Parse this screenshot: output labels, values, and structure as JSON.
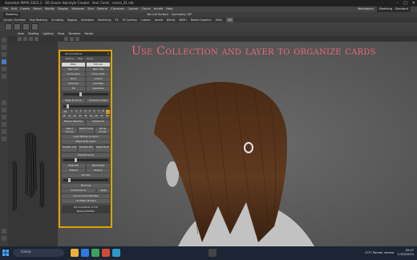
{
  "window": {
    "title": "Autodesk MAYA 2023.3 - 3D Groom Hairstyle Creator · Hair Cards · scene_01.mb",
    "controls": [
      "–",
      "□",
      "✕"
    ]
  },
  "menubar": {
    "items": [
      "File",
      "Edit",
      "Create",
      "Select",
      "Modify",
      "Display",
      "Windows",
      "Skin",
      "Deform",
      "Constrain",
      "Control",
      "Cache",
      "Arnold",
      "Help"
    ],
    "workspace_label": "Workspace:",
    "workspace_value": "Modeling - Standard"
  },
  "statusline": {
    "mode": "Modeling",
    "items": [
      "No Live Surface",
      "Symmetry: Off"
    ]
  },
  "shelf": {
    "tabs": [
      "Curves / Surfaces",
      "Poly Modeling",
      "Sculpting",
      "Rigging",
      "Animation",
      "Rendering",
      "FX",
      "FX Caching",
      "Custom",
      "Arnold",
      "Bifrost",
      "MASH",
      "Motion Graphics",
      "XGen",
      "GS"
    ],
    "active_tab": "GS"
  },
  "panel_menu": [
    "View",
    "Shading",
    "Lighting",
    "Show",
    "Renderer",
    "Panels"
  ],
  "viewport": {
    "heading": "Use Collection and layer to organize cards"
  },
  "gs_panel": {
    "title": "GS CurveTools",
    "close": "✕",
    "menu": [
      "Options",
      "Help",
      "About"
    ],
    "buttons": {
      "warp": "Warp",
      "extrude": "Extrude",
      "new_card": "New Card",
      "new_tube": "New Tube",
      "curve_card": "Curve Card",
      "curve_tube": "Curve Tube",
      "bind": "Bind",
      "unbind": "Unbind",
      "add_card": "Add Card",
      "add_tube": "Add Tube",
      "fill": "Fill",
      "subdivide": "Subdivide",
      "edge_to_curve": "Edge To Curve",
      "cards_to_curves": "Cards To Curves",
      "all": "All",
      "layer_row": [
        "1",
        "2",
        "3",
        "4",
        "5",
        "6",
        "7",
        "8",
        "9"
      ],
      "layer_row2": [
        "10",
        "11",
        "12",
        "13",
        "14",
        "15",
        "16",
        "17",
        "18"
      ],
      "extract_selected": "Extract Selected",
      "extract_all": "Extract All",
      "select_curves": "Select Curves",
      "select_cards": "Select Cards",
      "group_curves": "Group Curves",
      "layer_names_colors": "Layer Names & Colors",
      "regroup_by_layer": "Regroup By Layer",
      "transfer_uvs": "Transfer UVs",
      "transfer_attr": "Transfer Attr.",
      "reset_pivot": "Reset Pivot",
      "smooth_curve": "Smooth Curve",
      "duplicate": "Duplicate",
      "randomize": "Randomize",
      "extend": "Extend",
      "reduce": "Reduce",
      "smooth": "Smooth",
      "mirroring": "Mirroring",
      "control_curve": "Control Curve",
      "apply": "Apply",
      "curve_control_window": "Curve Control Window",
      "uv_editor_window": "UV Editor Window",
      "footer1": "GS CurveTools v1.3.8",
      "footer2": "Personal Edition"
    }
  },
  "taskbar": {
    "search_placeholder": "Cerca",
    "weather": "23°C  Parzial. sereno",
    "time": "09:47",
    "date": "17/05/2024"
  },
  "colors": {
    "accent_heading": "#e86a78",
    "panel_border": "#e0a100",
    "selected_tool": "#4a7fbf"
  }
}
